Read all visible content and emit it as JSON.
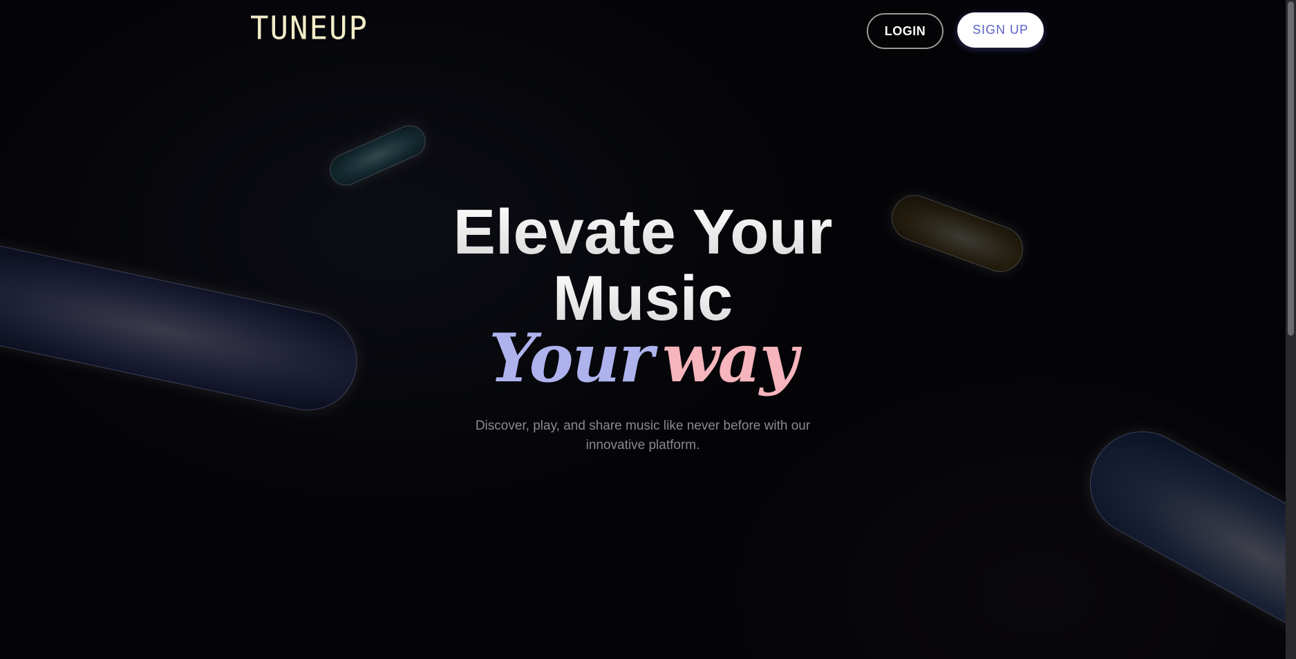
{
  "header": {
    "logo_text": "TUNEUP",
    "login_label": "LOGIN",
    "signup_label": "SIGN UP"
  },
  "hero": {
    "title_line_1": "Elevate Your",
    "title_line_2": "Music",
    "script_word_1": "Your",
    "script_word_2": "way",
    "subtitle_line_1": "Discover, play, and share music like never before with our",
    "subtitle_line_2": "innovative platform."
  },
  "colors": {
    "background": "#040407",
    "logo": "#f2edc8",
    "script_your": "#aeb3ee",
    "script_way": "#f6b4bd",
    "signup_text": "#5b5fc7"
  }
}
